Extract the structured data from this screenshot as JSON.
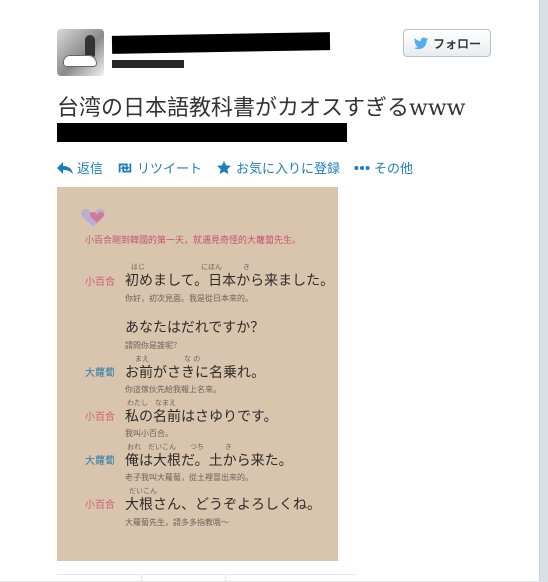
{
  "tweet": {
    "follow_label": "フォロー",
    "text": "台湾の日本語教科書がカオスすぎるwww",
    "actions": [
      {
        "label": "返信",
        "icon": "reply-icon"
      },
      {
        "label": "リツイート",
        "icon": "retweet-icon"
      },
      {
        "label": "お気に入りに登録",
        "icon": "star-icon"
      },
      {
        "label": "その他",
        "icon": "more-icon"
      }
    ]
  },
  "photo": {
    "intro": "小百合剛到韓國的第一天，就遇見奇怪的大蘿蔔先生。",
    "lines": [
      {
        "speaker": "小百合",
        "ruby": "はじ　　　　　　　　にほん　　　き",
        "jp": "初めまして。日本から来ました。",
        "zh": "你好，初次見面。我是從日本來的。",
        "speaker_color": "#d25a73"
      },
      {
        "speaker": "",
        "ruby": "",
        "jp": "あなたはだれですか？",
        "zh": "請問你是誰呢？",
        "speaker_color": "#d25a73"
      },
      {
        "speaker": "大蘿蔔",
        "ruby": "まえ　　　　　な の",
        "jp": "お前がさきに名乗れ。",
        "zh": "你這傢伙先給我報上名來。",
        "speaker_color": "#2c7aa8"
      },
      {
        "speaker": "小百合",
        "ruby": "わたし　なまえ",
        "jp": "私の名前はさゆりです。",
        "zh": "我叫小百合。",
        "speaker_color": "#d25a73"
      },
      {
        "speaker": "大蘿蔔",
        "ruby": "おれ　だいこん　　つち　　　き",
        "jp": "俺は大根だ。土から来た。",
        "zh": "老子我叫大蘿蔔，從土裡冒出來的。",
        "speaker_color": "#2c7aa8"
      },
      {
        "speaker": "小百合",
        "ruby": "だいこん",
        "jp": "大根さん、どうぞよろしくね。",
        "zh": "大蘿蔔先生，請多多指教哦～",
        "speaker_color": "#d25a73"
      }
    ]
  }
}
